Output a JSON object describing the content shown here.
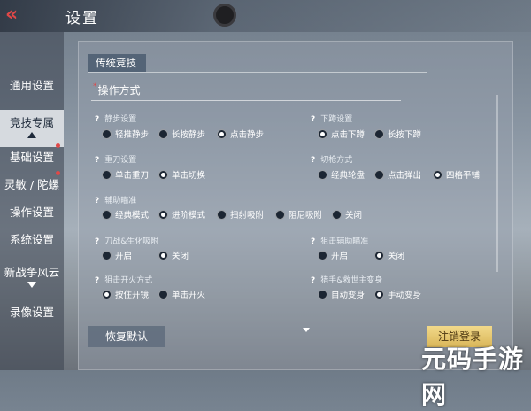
{
  "header": {
    "back_icon": "back-chevrons-icon",
    "title": "设置"
  },
  "sidebar": {
    "items": [
      {
        "label": "通用设置"
      },
      {
        "label": "竞技专属",
        "active": true
      },
      {
        "label": "基础设置",
        "badge": true
      },
      {
        "label": "灵敏 / 陀螺",
        "badge": true
      },
      {
        "label": "操作设置"
      },
      {
        "label": "系统设置"
      },
      {
        "label": "新战争风云"
      },
      {
        "label": "录像设置"
      }
    ]
  },
  "panel": {
    "tab": "传统竞技",
    "section": "操作方式",
    "options": [
      {
        "title": "静步设置",
        "choices": [
          "轻推静步",
          "长按静步",
          "点击静步"
        ],
        "selected": 2
      },
      {
        "title": "下蹲设置",
        "choices": [
          "点击下蹲",
          "长按下蹲"
        ],
        "selected": 0
      },
      {
        "title": "重刀设置",
        "choices": [
          "单击重刀",
          "单击切换"
        ],
        "selected": 1
      },
      {
        "title": "切枪方式",
        "choices": [
          "经典轮盘",
          "点击弹出",
          "四格平铺"
        ],
        "selected": 2
      },
      {
        "title": "辅助瞄准",
        "choices": [
          "经典模式",
          "进阶模式",
          "扫射吸附",
          "阻尼吸附",
          "关闭"
        ],
        "selected": 1
      },
      {
        "title": "刀战&生化吸附",
        "choices": [
          "开启",
          "关闭"
        ],
        "selected": 1
      },
      {
        "title": "狙击辅助瞄准",
        "choices": [
          "开启",
          "关闭"
        ],
        "selected": 1
      },
      {
        "title": "狙击开火方式",
        "choices": [
          "按住开镜",
          "单击开火"
        ],
        "selected": 0
      },
      {
        "title": "猎手&救世主变身",
        "choices": [
          "自动变身",
          "手动变身"
        ],
        "selected": 1
      }
    ]
  },
  "footer": {
    "reset": "恢复默认",
    "logout": "注销登录"
  },
  "watermark": "元码手游网"
}
